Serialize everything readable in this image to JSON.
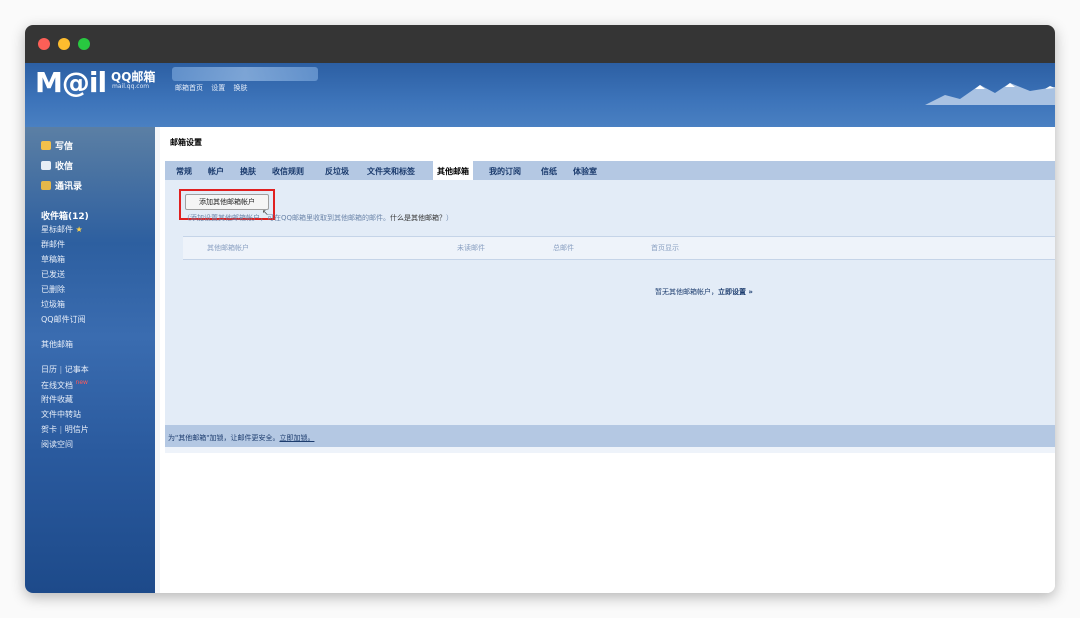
{
  "window": {
    "titlebar": {
      "buttons": [
        "close",
        "minimize",
        "maximize"
      ]
    }
  },
  "header": {
    "logo_text": "M@il",
    "brand": "QQ邮箱",
    "domain": "mail.qq.com",
    "top_links": [
      "邮箱首页",
      "设置",
      "换肤"
    ]
  },
  "sidebar": {
    "actions": [
      {
        "label": "写信",
        "icon": "pencil-icon"
      },
      {
        "label": "收信",
        "icon": "inbox-icon"
      },
      {
        "label": "通讯录",
        "icon": "contacts-icon"
      }
    ],
    "inbox": "收件箱(12)",
    "starred": "星标邮件",
    "starred_icon": "★",
    "folders": [
      "群邮件",
      "草稿箱",
      "已发送",
      "已删除",
      "垃圾箱",
      "QQ邮件订阅"
    ],
    "other_mail": "其他邮箱",
    "calendar": "日历",
    "notebook": "记事本",
    "docs": "在线文档",
    "docs_badge": "new",
    "attachments": "附件收藏",
    "transfer": "文件中转站",
    "cards": "贺卡",
    "postcards": "明信片",
    "reading": "阅读空间"
  },
  "main": {
    "title": "邮箱设置",
    "tabs": [
      "常规",
      "帐户",
      "换肤",
      "收信规则",
      "反垃圾",
      "文件夹和标签",
      "其他邮箱",
      "我的订阅",
      "信纸",
      "体验室"
    ],
    "active_tab": "其他邮箱",
    "add_button": "添加其他邮箱帐户",
    "hint_prefix": "（添加设置其他邮箱帐户，可在QQ邮箱里收取到其他邮箱的邮件。",
    "hint_question": "什么是其他邮箱？",
    "hint_suffix": "）",
    "table_headers": [
      "其他邮箱帐户",
      "未读邮件",
      "总邮件",
      "首页显示"
    ],
    "empty_text": "暂无其他邮箱帐户，",
    "empty_link": "立即设置 »",
    "footer_text": "为\"其他邮箱\"加锁，让邮件更安全。",
    "footer_link": "立即加锁。"
  },
  "colors": {
    "header_blue": "#3d74ba",
    "tab_bar": "#b4c8e3",
    "panel_bg": "#e3ecf7",
    "highlight_red": "#e02020"
  }
}
